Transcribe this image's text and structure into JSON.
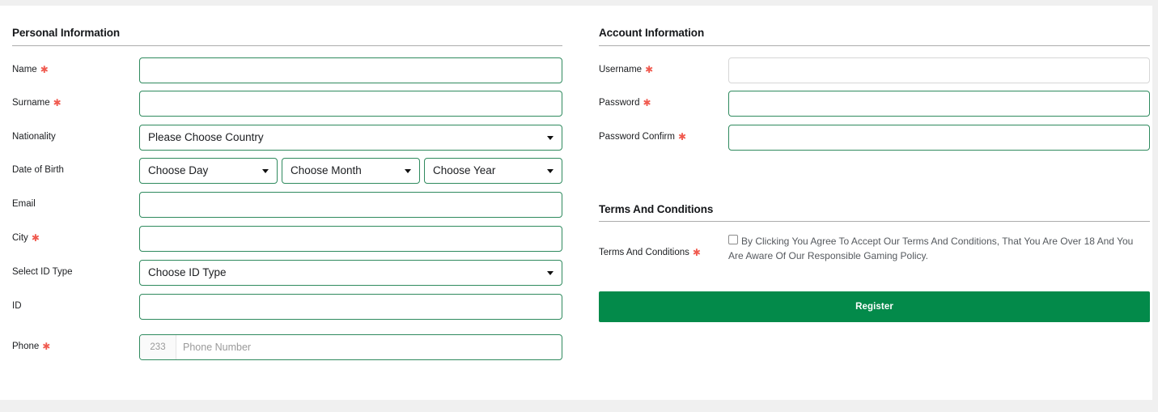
{
  "personal": {
    "section_title": "Personal Information",
    "fields": [
      {
        "label": "Name",
        "required": true,
        "type": "text",
        "value": "",
        "placeholder": ""
      },
      {
        "label": "Surname",
        "required": true,
        "type": "text",
        "value": "",
        "placeholder": ""
      },
      {
        "label": "Nationality",
        "required": false,
        "type": "select",
        "value": "Please Choose Country"
      },
      {
        "label": "Date of Birth",
        "required": false,
        "type": "date-group"
      },
      {
        "label": "Email",
        "required": false,
        "type": "text",
        "value": "",
        "placeholder": ""
      },
      {
        "label": "City",
        "required": true,
        "type": "text",
        "value": "",
        "placeholder": ""
      },
      {
        "label": "Select ID Type",
        "required": false,
        "type": "select",
        "value": "Choose ID Type"
      },
      {
        "label": "ID",
        "required": false,
        "type": "text",
        "value": "",
        "placeholder": ""
      },
      {
        "label": "Phone",
        "required": true,
        "type": "phone",
        "value": "",
        "placeholder": "Phone Number",
        "prefix": "233"
      }
    ],
    "dob": {
      "day": "Choose Day",
      "month": "Choose Month",
      "year": "Choose Year"
    }
  },
  "account": {
    "section_title": "Account Information",
    "fields": [
      {
        "label": "Username",
        "required": true,
        "type": "text",
        "value": "",
        "placeholder": "",
        "border": "grey"
      },
      {
        "label": "Password",
        "required": true,
        "type": "password",
        "value": "",
        "placeholder": "",
        "border": "green"
      },
      {
        "label": "Password Confirm",
        "required": true,
        "type": "password",
        "value": "",
        "placeholder": "",
        "border": "green"
      }
    ]
  },
  "terms": {
    "section_title": "Terms And Conditions",
    "label": "Terms And Conditions",
    "required": true,
    "checked": false,
    "text": "By Clicking You Agree To Accept Our Terms And Conditions, That You Are Over 18 And You Are Aware Of Our Responsible Gaming Policy."
  },
  "actions": {
    "register_label": "Register"
  },
  "markers": {
    "required_glyph": "✱"
  },
  "colors": {
    "brand_green": "#038a4a",
    "input_border_green": "#2f8a5e",
    "input_border_grey": "#d6d6d6",
    "required_red": "#f05a4f",
    "page_background": "#f0f0f0",
    "card_background": "#ffffff"
  }
}
